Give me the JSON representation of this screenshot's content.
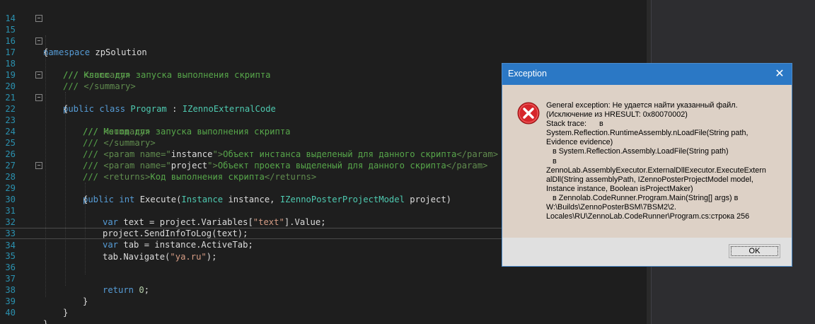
{
  "editor": {
    "line_numbers": [
      "14",
      "15",
      "16",
      "17",
      "18",
      "19",
      "20",
      "21",
      "22",
      "23",
      "24",
      "25",
      "26",
      "27",
      "28",
      "29",
      "30",
      "31",
      "32",
      "33",
      "34",
      "35",
      "36",
      "37",
      "38",
      "39",
      "40"
    ],
    "tokens": {
      "kw_namespace": "namespace",
      "ns_name": " zpSolution",
      "brace_open": "{",
      "brace_close": "}",
      "doc_prefix": "/// ",
      "tag_summary_open": "<summary>",
      "tag_summary_close": "</summary>",
      "doc_class": "/// Класс для запуска выполнения скрипта",
      "kw_public": "public",
      "kw_class": " class ",
      "class_name": "Program",
      "colon": " : ",
      "iface": "IZennoExternalCode",
      "doc_method": "/// Метод для запуска выполнения скрипта",
      "param_open": "<param name=",
      "q": "\"",
      "param_instance": "instance",
      "param_project": "project",
      "gt": ">",
      "param_instance_desc": "Объект инстанса выделеный для данного скрипта",
      "param_project_desc": "Объект проекта выделеный для данного скрипта",
      "param_close": "</param>",
      "returns_open": "<returns>",
      "returns_desc": "Код выполнения скрипта",
      "returns_close": "</returns>",
      "kw_int": " int ",
      "method": "Execute(",
      "type_instance": "Instance",
      "arg_instance": " instance, ",
      "type_model": "IZennoPosterProjectModel",
      "arg_project": " project)",
      "kw_var": "var",
      "l31_a": " text = project.Variables[",
      "str_text": "\"text\"",
      "l31_b": "].Value;",
      "l32": "project.SendInfoToLog(text);",
      "l33_a": " tab = instance.ActiveTab;",
      "l34_a": "tab.Navigate(",
      "str_ya": "\"ya.ru\"",
      "l34_b": ");",
      "kw_return": "return",
      "num_zero": " 0",
      "semicolon": ";",
      "fold_minus": "−"
    }
  },
  "dialog": {
    "title": "Exception",
    "close_glyph": "✕",
    "message_lines": [
      "General exception: Не удается найти указанный файл.",
      "(Исключение из HRESULT: 0x80070002)",
      "Stack trace:      в",
      "System.Reflection.RuntimeAssembly.nLoadFile(String path,",
      "Evidence evidence)",
      "   в System.Reflection.Assembly.LoadFile(String path)",
      "   в",
      "ZennoLab.AssemblyExecutor.ExternalDllExecutor.ExecuteExtern",
      "alDll(String assemblyPath, IZennoPosterProjectModel model,",
      "Instance instance, Boolean isProjectMaker)",
      "   в Zennolab.CodeRunner.Program.Main(String[] args) в",
      "W:\\Builds\\ZennoPosterBSM\\7BSM2\\2.",
      "Locales\\RU\\ZennoLab.CodeRunner\\Program.cs:строка 256"
    ],
    "ok_label": "OK",
    "icon": "error-icon",
    "colors": {
      "title_bar": "#2b78c5",
      "body": "#ddd1c6",
      "error_red": "#d6262b"
    }
  }
}
